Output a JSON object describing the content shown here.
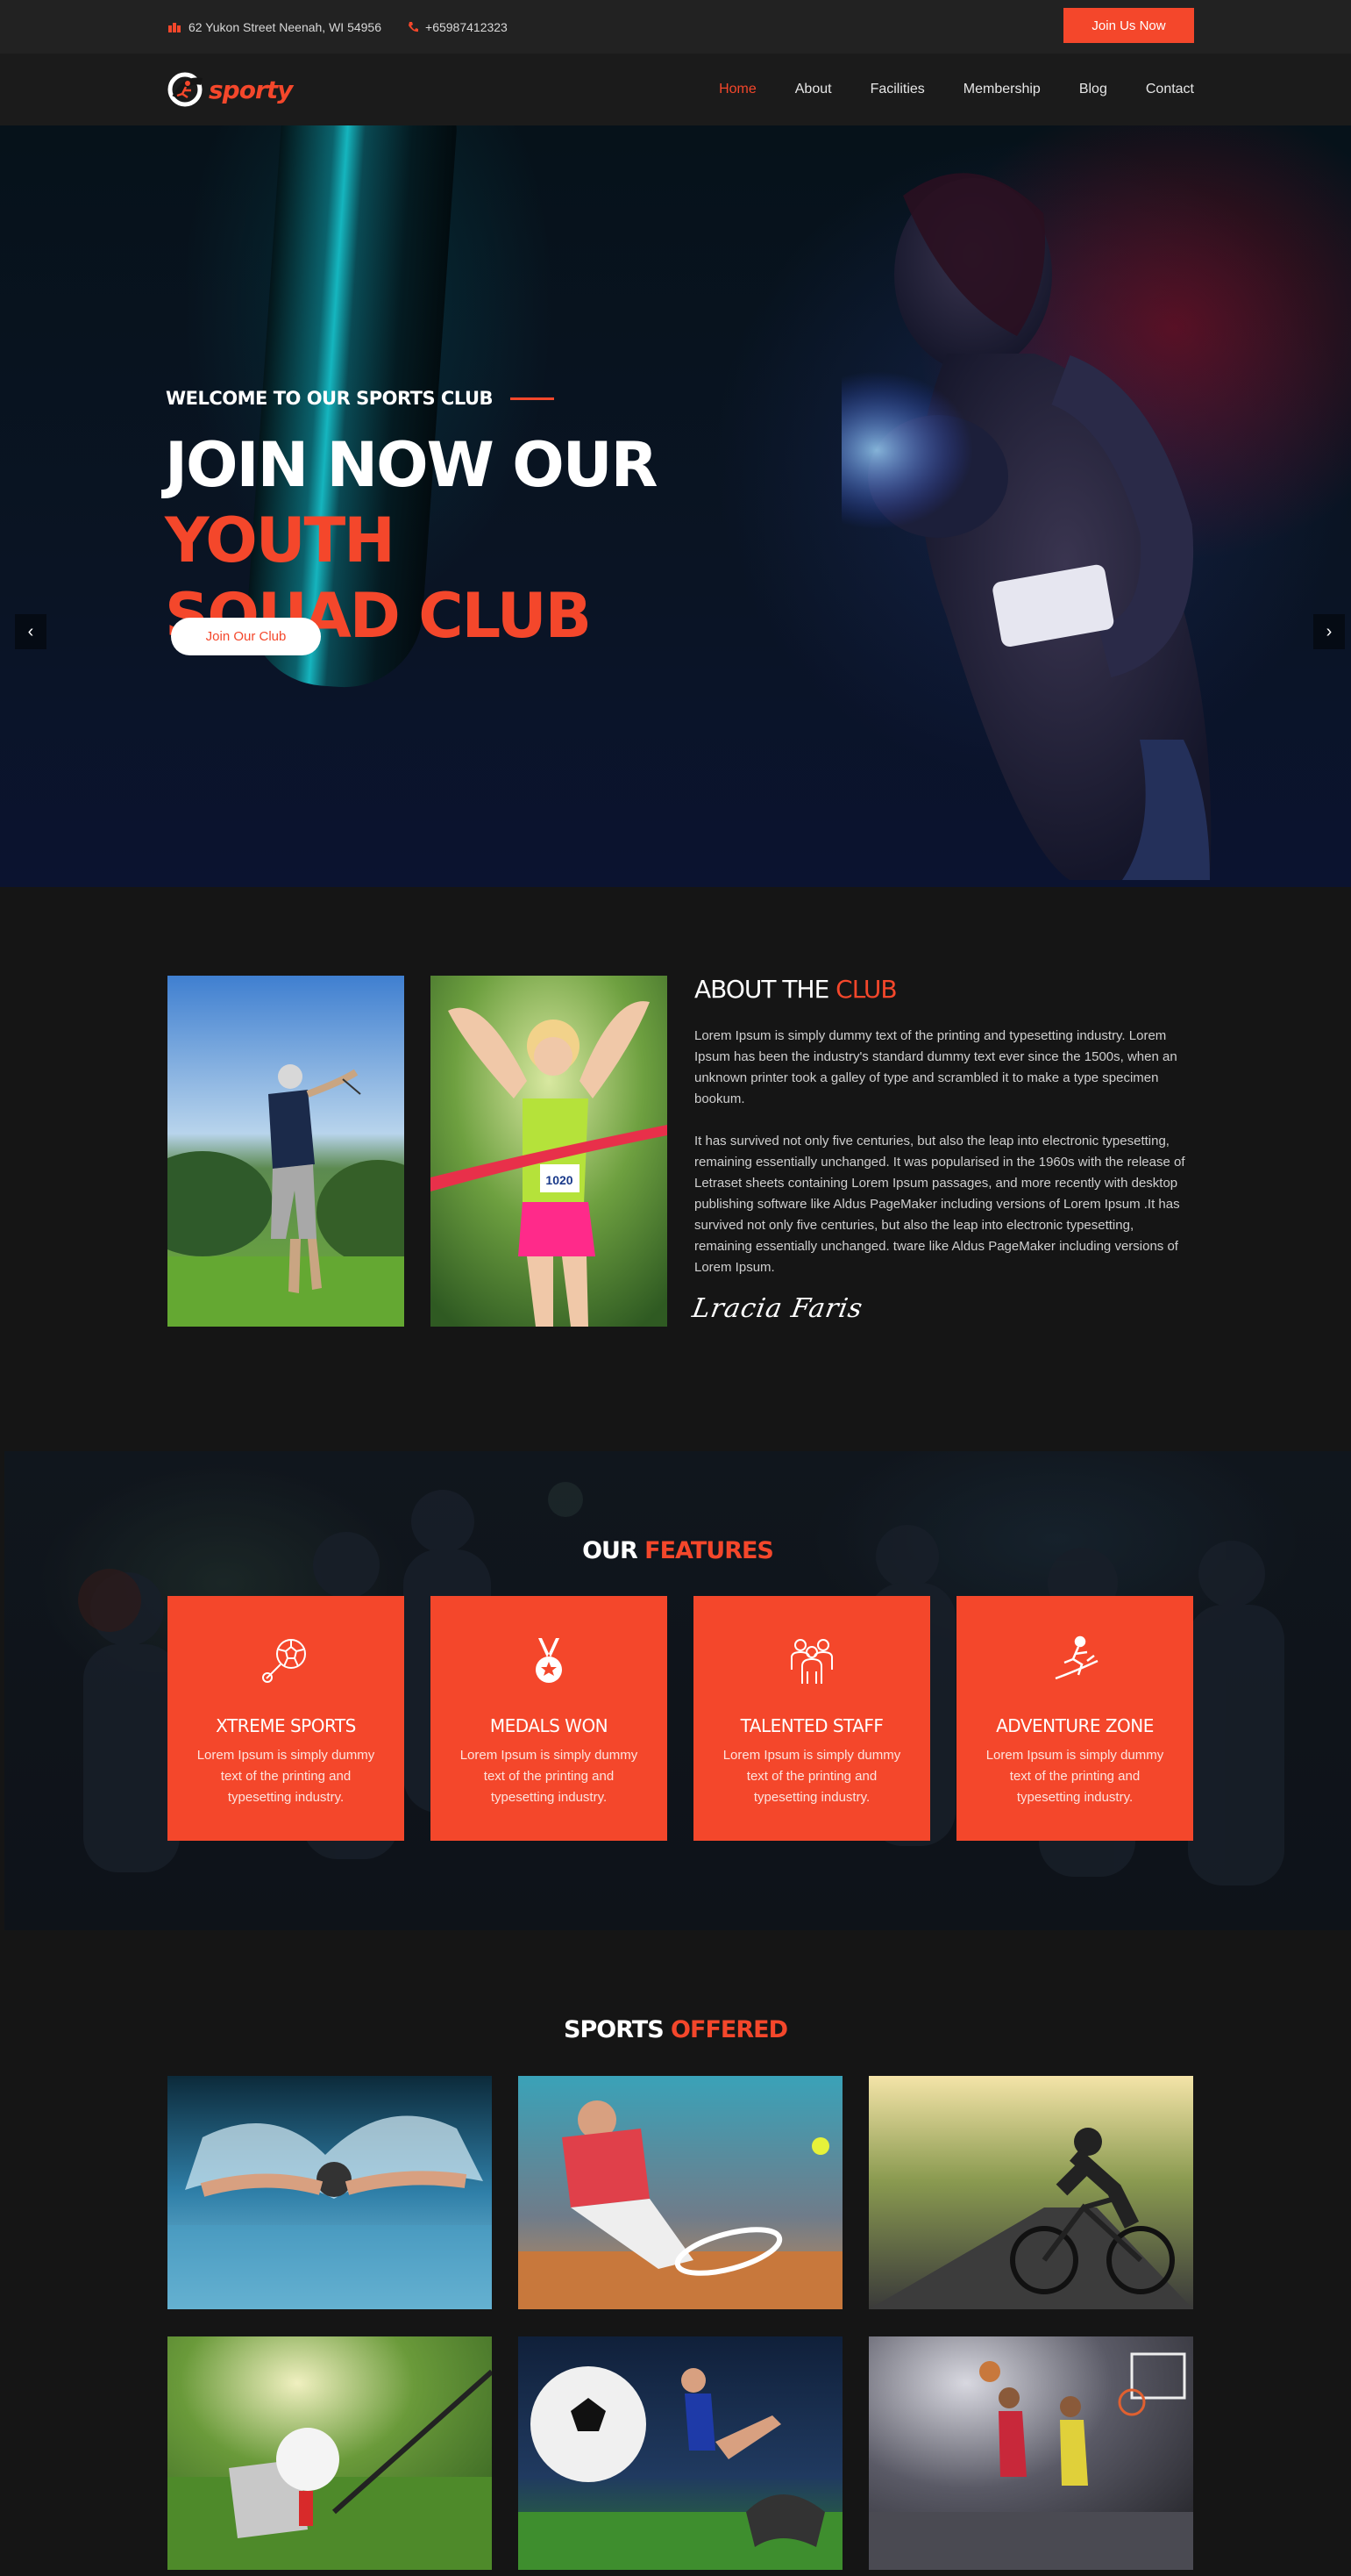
{
  "topbar": {
    "address": "62 Yukon Street Neenah, WI 54956",
    "phone": "+65987412323",
    "join_label": "Join Us Now"
  },
  "brand": {
    "name": "sporty"
  },
  "nav": {
    "items": [
      {
        "label": "Home",
        "active": true
      },
      {
        "label": "About",
        "active": false
      },
      {
        "label": "Facilities",
        "active": false
      },
      {
        "label": "Membership",
        "active": false
      },
      {
        "label": "Blog",
        "active": false
      },
      {
        "label": "Contact",
        "active": false
      }
    ]
  },
  "hero": {
    "subtitle": "WELCOME TO OUR SPORTS CLUB",
    "title_white": "JOIN NOW OUR ",
    "title_accent_1": "YOUTH",
    "title_accent_2": "SQUAD CLUB",
    "button_label": "Join Our Club",
    "prev_arrow": "‹",
    "next_arrow": "›"
  },
  "about": {
    "title_white": "ABOUT THE ",
    "title_accent": "CLUB",
    "paragraph_1": "Lorem Ipsum is simply dummy text of the printing and typesetting industry. Lorem Ipsum has been the industry's standard dummy text ever since the 1500s, when an unknown printer took a galley of type and scrambled it to make a type specimen bookum.",
    "paragraph_2": "It has survived not only five centuries, but also the leap into electronic typesetting, remaining essentially unchanged. It was popularised in the 1960s with the release of Letraset sheets containing Lorem Ipsum passages, and more recently with desktop publishing software like Aldus PageMaker including versions of Lorem Ipsum .It has survived not only five centuries, but also the leap into electronic typesetting, remaining essentially unchanged. tware like Aldus PageMaker including versions of Lorem Ipsum.",
    "signature": "Lracia Faris",
    "bib_number": "1020"
  },
  "features": {
    "title_white": "OUR ",
    "title_accent": "FEATURES",
    "cards": [
      {
        "title": "XTREME SPORTS",
        "desc": "Lorem Ipsum is simply dummy text of the printing and typesetting industry.",
        "icon": "soccer-ball-icon"
      },
      {
        "title": "MEDALS WON",
        "desc": "Lorem Ipsum is simply dummy text of the printing and typesetting industry.",
        "icon": "medal-icon"
      },
      {
        "title": "TALENTED STAFF",
        "desc": "Lorem Ipsum is simply dummy text of the printing and typesetting industry.",
        "icon": "team-icon"
      },
      {
        "title": "ADVENTURE ZONE",
        "desc": "Lorem Ipsum is simply dummy text of the printing and typesetting industry.",
        "icon": "surfer-icon"
      }
    ]
  },
  "sports": {
    "title_white": "SPORTS ",
    "title_accent": "OFFERED",
    "tiles": [
      "swimming",
      "tennis",
      "cycling",
      "golf",
      "football",
      "basketball"
    ]
  },
  "colors": {
    "accent": "#f4472b",
    "dark": "#151515",
    "topbar": "#222222"
  }
}
